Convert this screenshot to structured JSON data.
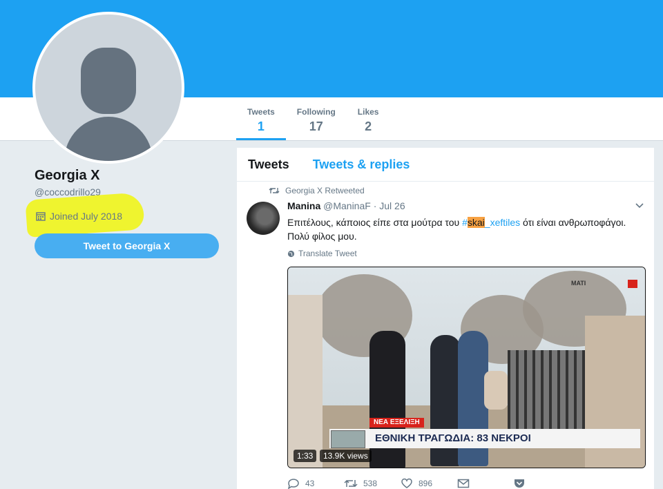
{
  "profile": {
    "name": "Georgia X",
    "handle": "@coccodrillo29",
    "joined": "Joined July 2018",
    "tweet_to_label": "Tweet to Georgia X"
  },
  "stats": [
    {
      "label": "Tweets",
      "value": "1",
      "active": true
    },
    {
      "label": "Following",
      "value": "17",
      "active": false
    },
    {
      "label": "Likes",
      "value": "2",
      "active": false
    }
  ],
  "timeline_tabs": {
    "tweets": "Tweets",
    "replies": "Tweets & replies"
  },
  "tweet": {
    "retweet_context": "Georgia X Retweeted",
    "display_name": "Manina",
    "user_handle": "@ManinaF",
    "date": "· Jul 26",
    "text_before": "Επιτέλους, κάποιος είπε στα μούτρα του ",
    "hash_prefix": "#",
    "hash_highlight": "skai",
    "hash_rest": "_xeftiles",
    "text_after": " ότι είναι ανθρωποφάγοι.",
    "text_line2": "Πολύ φίλος μου.",
    "translate_label": "Translate Tweet",
    "video": {
      "duration": "1:33",
      "views": "13.9K views",
      "overlay_red": "ΝΕΑ ΕΞΕΛΙΞΗ",
      "overlay_headline": "ΕΘΝΙΚΗ ΤΡΑΓΩΔΙΑ: 83 ΝΕΚΡΟΙ",
      "location_tag": "ΜΑΤΙ"
    },
    "actions": {
      "replies": "43",
      "retweets": "538",
      "likes": "896"
    }
  },
  "colors": {
    "accent": "#1da1f2",
    "highlighter": "#f0f41e"
  }
}
